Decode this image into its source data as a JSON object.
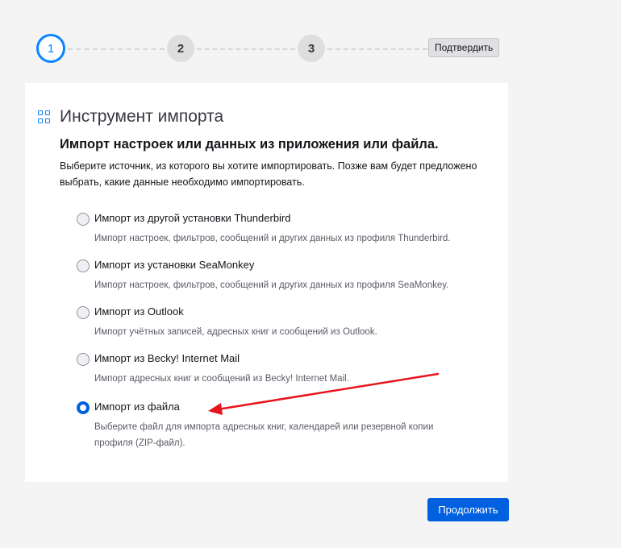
{
  "stepper": {
    "steps": [
      "1",
      "2",
      "3"
    ],
    "confirm_label": "Подтвердить"
  },
  "card": {
    "title": "Инструмент импорта",
    "subtitle": "Импорт настроек или данных из приложения или файла.",
    "description": "Выберите источник, из которого вы хотите импортировать. Позже вам будет предложено выбрать, какие данные необходимо импортировать.",
    "options": [
      {
        "label": "Импорт из другой установки Thunderbird",
        "description": "Импорт настроек, фильтров, сообщений и других данных из профиля Thunderbird.",
        "checked": false
      },
      {
        "label": "Импорт из установки SeaMonkey",
        "description": "Импорт настроек, фильтров, сообщений и других данных из профиля SeaMonkey.",
        "checked": false
      },
      {
        "label": "Импорт из Outlook",
        "description": "Импорт учётных записей, адресных книг и сообщений из Outlook.",
        "checked": false
      },
      {
        "label": "Импорт из Becky! Internet Mail",
        "description": "Импорт адресных книг и сообщений из Becky! Internet Mail.",
        "checked": false
      },
      {
        "label": "Импорт из файла",
        "description": "Выберите файл для импорта адресных книг, календарей или резервной копии профиля (ZIP-файл).",
        "checked": true
      }
    ]
  },
  "continue_label": "Продолжить",
  "colors": {
    "accent": "#0a84ff",
    "primary_button": "#0061e0",
    "annotation_arrow": "#e8141c"
  }
}
